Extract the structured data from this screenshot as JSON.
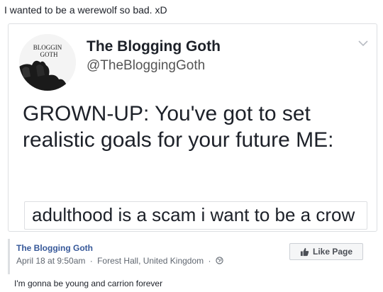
{
  "post": {
    "caption": "I wanted to be a werewolf so bad. xD",
    "comment": "I'm gonna be young and carrion forever"
  },
  "tweet": {
    "avatar_text_line1": "BLOGGIN",
    "avatar_text_line2": "GOTH",
    "name": "The Blogging Goth",
    "handle": "@TheBloggingGoth",
    "text": "GROWN-UP: You've got to set realistic goals for your future ME:",
    "quote": "adulthood is a scam i want to be a crow"
  },
  "footer": {
    "page_name": "The Blogging Goth",
    "date": "April 18 at 9:50am",
    "separator": "·",
    "location": "Forest Hall, United Kingdom",
    "like_label": "Like Page"
  },
  "icons": {
    "chevron": "chevron-down-icon",
    "globe": "globe-icon",
    "like": "thumbs-up-icon"
  },
  "colors": {
    "link": "#365899",
    "border": "#dddfe2",
    "meta": "#606770"
  }
}
